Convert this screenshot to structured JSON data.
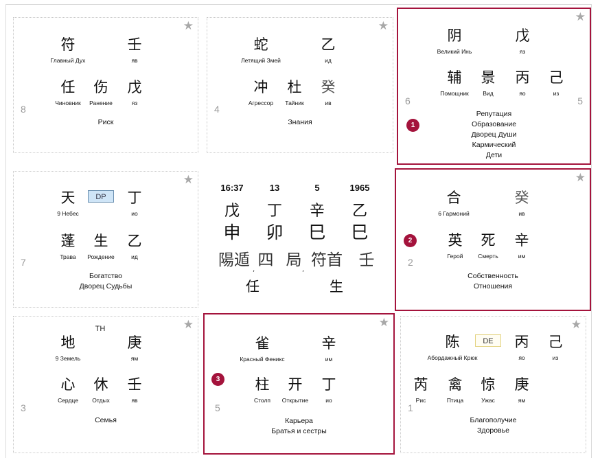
{
  "cells": [
    {
      "palace_num": "8",
      "top": [
        {
          "char": "符",
          "label": "Главный Дух"
        },
        {
          "char": "壬",
          "label": "яв"
        }
      ],
      "bottom": [
        {
          "char": "任",
          "label": "Чиновник"
        },
        {
          "char": "伤",
          "label": "Ранение"
        },
        {
          "char": "戊",
          "label": "яз"
        }
      ],
      "notes": [
        "Риск"
      ]
    },
    {
      "palace_num": "4",
      "top": [
        {
          "char": "蛇",
          "label": "Летящий Змей"
        },
        {
          "char": "乙",
          "label": "ид"
        }
      ],
      "bottom": [
        {
          "char": "冲",
          "label": "Агрессор"
        },
        {
          "char": "杜",
          "label": "Тайник"
        },
        {
          "char": "癸",
          "label": "ив"
        }
      ],
      "notes": [
        "Знания"
      ]
    },
    {
      "palace_num": "6",
      "extra_num": "5",
      "badge": "1",
      "top": [
        {
          "char": "阴",
          "label": "Великий Инь"
        },
        {
          "char": "戊",
          "label": "яз"
        }
      ],
      "bottom": [
        {
          "char": "辅",
          "label": "Помощник"
        },
        {
          "char": "景",
          "label": "Вид"
        },
        {
          "char": "丙",
          "label": "яо"
        },
        {
          "char": "己",
          "label": "из"
        }
      ],
      "notes": [
        "Репутация",
        "Образование",
        "Дворец Души",
        "Кармический",
        "Дети"
      ]
    },
    {
      "palace_num": "7",
      "tag": "DP",
      "top": [
        {
          "char": "天",
          "label": "9 Небес"
        },
        {
          "char": "丁",
          "label": "ио"
        }
      ],
      "bottom": [
        {
          "char": "蓬",
          "label": "Трава"
        },
        {
          "char": "生",
          "label": "Рождение"
        },
        {
          "char": "乙",
          "label": "ид"
        }
      ],
      "notes": [
        "Богатство",
        "Дворец Судьбы"
      ]
    },
    {
      "palace_num": "2",
      "badge": "2",
      "top": [
        {
          "char": "合",
          "label": "6 Гармоний"
        },
        {
          "char": "癸",
          "label": "ив"
        }
      ],
      "bottom": [
        {
          "char": "英",
          "label": "Герой"
        },
        {
          "char": "死",
          "label": "Смерть"
        },
        {
          "char": "辛",
          "label": "им"
        }
      ],
      "notes": [
        "Собственность",
        "Отношения"
      ]
    },
    {
      "palace_num": "3",
      "tag": "TH",
      "top": [
        {
          "char": "地",
          "label": "9 Земель"
        },
        {
          "char": "庚",
          "label": "ям"
        }
      ],
      "bottom": [
        {
          "char": "心",
          "label": "Сердце"
        },
        {
          "char": "休",
          "label": "Отдых"
        },
        {
          "char": "壬",
          "label": "яв"
        }
      ],
      "notes": [
        "Семья"
      ]
    },
    {
      "palace_num": "5",
      "badge": "3",
      "top": [
        {
          "char": "雀",
          "label": "Красный Феникс"
        },
        {
          "char": "辛",
          "label": "им"
        }
      ],
      "bottom": [
        {
          "char": "柱",
          "label": "Столп"
        },
        {
          "char": "开",
          "label": "Открытие"
        },
        {
          "char": "丁",
          "label": "ио"
        }
      ],
      "notes": [
        "Карьера",
        "Братья и сестры"
      ]
    },
    {
      "palace_num": "1",
      "tag": "DE",
      "top": [
        {
          "char": "陈",
          "label": "Абордажный Крюк"
        },
        {
          "char": "丙",
          "label": "яо"
        },
        {
          "char": "己",
          "label": "из"
        }
      ],
      "bottom": [
        {
          "char": "芮",
          "label": "Рис"
        },
        {
          "char": "禽",
          "label": "Птица"
        },
        {
          "char": "惊",
          "label": "Ужас"
        },
        {
          "char": "庚",
          "label": "ям"
        }
      ],
      "notes": [
        "Благополучие",
        "Здоровье"
      ]
    }
  ],
  "center": {
    "header": [
      "16:37",
      "13",
      "5",
      "1965"
    ],
    "stems": [
      "戊",
      "丁",
      "辛",
      "乙"
    ],
    "branches": [
      "申",
      "卯",
      "巳",
      "巳"
    ],
    "row3": [
      "陽遁",
      "四",
      "局",
      "符首",
      "壬"
    ],
    "row4": [
      "任",
      "生"
    ]
  },
  "colors": {
    "highlight": "#a4133c",
    "badge": "#a4133c",
    "tag_blue": "#cfe5f7",
    "tag_yellow": "#fffdf3"
  },
  "icons": {
    "star": "star-icon"
  }
}
